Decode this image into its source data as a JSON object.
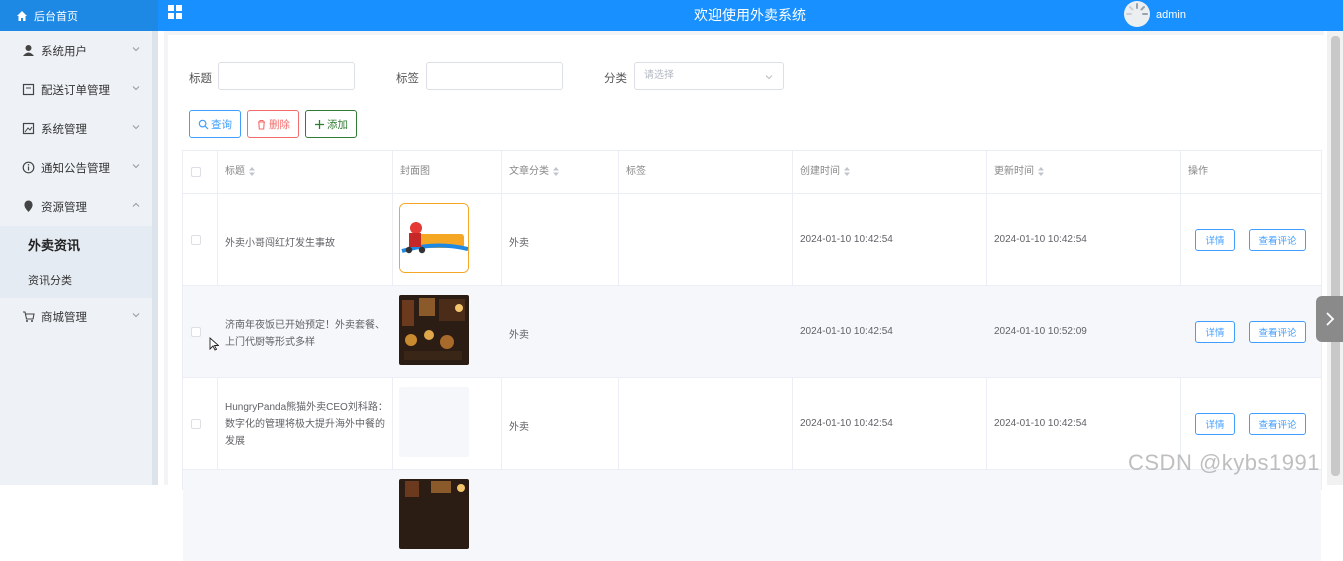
{
  "header": {
    "home_label": "后台首页",
    "system_title": "欢迎使用外卖系统",
    "username": "admin",
    "brand_color": "#1890ff"
  },
  "sidebar": {
    "items": [
      {
        "label": "系统用户",
        "icon": "user-icon"
      },
      {
        "label": "配送订单管理",
        "icon": "order-icon"
      },
      {
        "label": "系统管理",
        "icon": "image-icon"
      },
      {
        "label": "通知公告管理",
        "icon": "info-icon"
      },
      {
        "label": "资源管理",
        "icon": "location-icon",
        "expanded": true
      },
      {
        "label": "商城管理",
        "icon": "cart-icon"
      }
    ],
    "sub_items": [
      {
        "label": "外卖资讯",
        "active": true
      },
      {
        "label": "资讯分类",
        "active": false
      }
    ]
  },
  "filters": {
    "title_label": "标题",
    "tag_label": "标签",
    "category_label": "分类",
    "category_placeholder": "请选择"
  },
  "actions": {
    "search": "查询",
    "delete": "删除",
    "add": "添加"
  },
  "table": {
    "columns": [
      "标题",
      "封面图",
      "文章分类",
      "标签",
      "创建时间",
      "更新时间",
      "操作"
    ],
    "rows": [
      {
        "title_lines": [
          "外卖小哥闯红灯发生事故"
        ],
        "category": "外卖",
        "tag": "",
        "created": "2024-01-10 10:42:54",
        "updated": "2024-01-10 10:42:54",
        "cover": "food-delivery-logo"
      },
      {
        "title_lines": [
          "济南年夜饭已开始预定！外卖套餐、",
          "上门代厨等形式多样"
        ],
        "category": "外卖",
        "tag": "",
        "created": "2024-01-10 10:42:54",
        "updated": "2024-01-10 10:52:09",
        "cover": "restaurant-photo"
      },
      {
        "title_lines": [
          "HungryPanda熊猫外卖CEO刘科路：",
          "数字化的管理将极大提升海外中餐的",
          "发展"
        ],
        "category": "外卖",
        "tag": "",
        "created": "2024-01-10 10:42:54",
        "updated": "2024-01-10 10:42:54",
        "cover": "blank"
      }
    ],
    "detail_label": "详情",
    "comment_label": "查看评论"
  },
  "watermark": "CSDN @kybs1991"
}
